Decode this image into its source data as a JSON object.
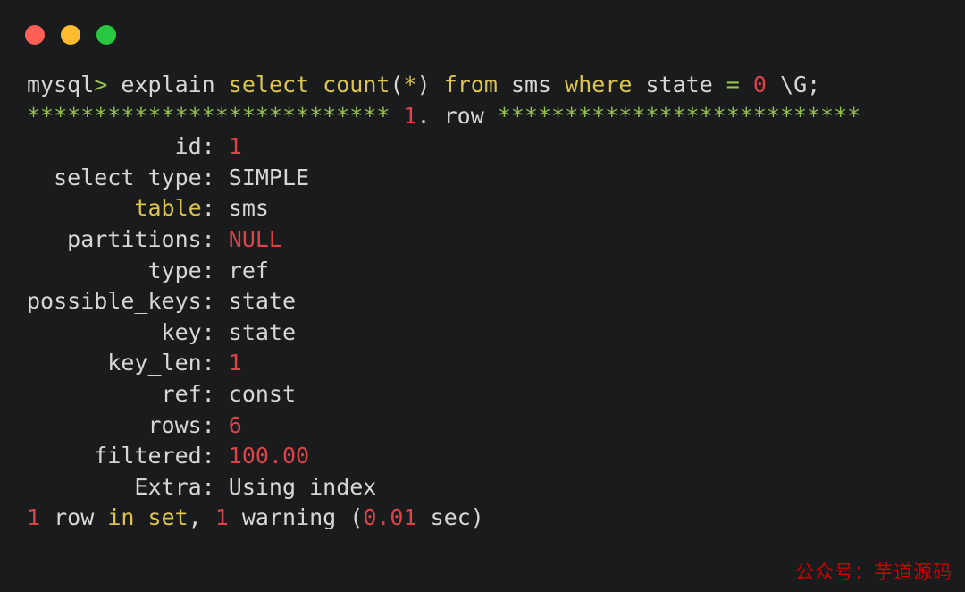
{
  "window": {
    "title": "mysql terminal",
    "background": "#1a1b1d",
    "traffic_lights": [
      {
        "name": "close",
        "label": "Close",
        "color": "#ff5f57"
      },
      {
        "name": "minimize",
        "label": "Minimize",
        "color": "#febc2e"
      },
      {
        "name": "zoom",
        "label": "Zoom",
        "color": "#28c840"
      }
    ]
  },
  "colors": {
    "foreground": "#d6d6d6",
    "keyword_yellow": "#dcc44e",
    "green": "#96c24f",
    "red": "#dc4349",
    "background": "#1a1b1d",
    "watermark_red": "#cc0000"
  },
  "terminal": {
    "prompt": "mysql> ",
    "command": "explain select count(*) from sms where state = 0 \\G;",
    "separator_left": "***************************",
    "separator_label": "1. row",
    "separator_right": "***************************",
    "lines": [
      {
        "id": "prompt-line",
        "segments": [
          {
            "text": "mysql",
            "color": "white"
          },
          {
            "text": ">",
            "color": "green"
          },
          {
            "text": " explain ",
            "color": "white"
          },
          {
            "text": "select",
            "color": "yellow"
          },
          {
            "text": " ",
            "color": "white"
          },
          {
            "text": "count",
            "color": "yellow"
          },
          {
            "text": "(",
            "color": "white"
          },
          {
            "text": "*",
            "color": "yellow"
          },
          {
            "text": ")",
            "color": "white"
          },
          {
            "text": " ",
            "color": "white"
          },
          {
            "text": "from",
            "color": "yellow"
          },
          {
            "text": " sms ",
            "color": "white"
          },
          {
            "text": "where",
            "color": "yellow"
          },
          {
            "text": " state ",
            "color": "white"
          },
          {
            "text": "=",
            "color": "green"
          },
          {
            "text": " ",
            "color": "white"
          },
          {
            "text": "0",
            "color": "red"
          },
          {
            "text": " \\G;",
            "color": "white"
          }
        ]
      },
      {
        "id": "row-separator",
        "segments": [
          {
            "text": "***************************",
            "color": "green"
          },
          {
            "text": " ",
            "color": "white"
          },
          {
            "text": "1",
            "color": "red"
          },
          {
            "text": ". row ",
            "color": "white"
          },
          {
            "text": "***************************",
            "color": "green"
          }
        ]
      },
      {
        "id": "field-id",
        "segments": [
          {
            "text": "           id: ",
            "color": "white"
          },
          {
            "text": "1",
            "color": "red"
          }
        ]
      },
      {
        "id": "field-select-type",
        "segments": [
          {
            "text": "  select_type: ",
            "color": "white"
          },
          {
            "text": "SIMPLE",
            "color": "white"
          }
        ]
      },
      {
        "id": "field-table",
        "segments": [
          {
            "text": "        ",
            "color": "white"
          },
          {
            "text": "table",
            "color": "yellow"
          },
          {
            "text": ": ",
            "color": "white"
          },
          {
            "text": "sms",
            "color": "white"
          }
        ]
      },
      {
        "id": "field-partitions",
        "segments": [
          {
            "text": "   partitions: ",
            "color": "white"
          },
          {
            "text": "NULL",
            "color": "red"
          }
        ]
      },
      {
        "id": "field-type",
        "segments": [
          {
            "text": "         type: ",
            "color": "white"
          },
          {
            "text": "ref",
            "color": "white"
          }
        ]
      },
      {
        "id": "field-possible-keys",
        "segments": [
          {
            "text": "possible_keys: ",
            "color": "white"
          },
          {
            "text": "state",
            "color": "white"
          }
        ]
      },
      {
        "id": "field-key",
        "segments": [
          {
            "text": "          key: ",
            "color": "white"
          },
          {
            "text": "state",
            "color": "white"
          }
        ]
      },
      {
        "id": "field-key-len",
        "segments": [
          {
            "text": "      key_len: ",
            "color": "white"
          },
          {
            "text": "1",
            "color": "red"
          }
        ]
      },
      {
        "id": "field-ref",
        "segments": [
          {
            "text": "          ref: ",
            "color": "white"
          },
          {
            "text": "const",
            "color": "white"
          }
        ]
      },
      {
        "id": "field-rows",
        "segments": [
          {
            "text": "         rows: ",
            "color": "white"
          },
          {
            "text": "6",
            "color": "red"
          }
        ]
      },
      {
        "id": "field-filtered",
        "segments": [
          {
            "text": "     filtered: ",
            "color": "white"
          },
          {
            "text": "100.00",
            "color": "red"
          }
        ]
      },
      {
        "id": "field-extra",
        "segments": [
          {
            "text": "        Extra: ",
            "color": "white"
          },
          {
            "text": "Using index",
            "color": "white"
          }
        ]
      },
      {
        "id": "status-line",
        "segments": [
          {
            "text": "1",
            "color": "red"
          },
          {
            "text": " row ",
            "color": "white"
          },
          {
            "text": "in set",
            "color": "yellow"
          },
          {
            "text": ", ",
            "color": "white"
          },
          {
            "text": "1",
            "color": "red"
          },
          {
            "text": " warning (",
            "color": "white"
          },
          {
            "text": "0.01",
            "color": "red"
          },
          {
            "text": " sec)",
            "color": "white"
          }
        ]
      }
    ],
    "explain_result": {
      "id": "1",
      "select_type": "SIMPLE",
      "table": "sms",
      "partitions": "NULL",
      "type": "ref",
      "possible_keys": "state",
      "key": "state",
      "key_len": "1",
      "ref": "const",
      "rows": "6",
      "filtered": "100.00",
      "Extra": "Using index"
    },
    "status": "1 row in set, 1 warning (0.01 sec)"
  },
  "watermark": {
    "text": "公众号：芋道源码"
  }
}
